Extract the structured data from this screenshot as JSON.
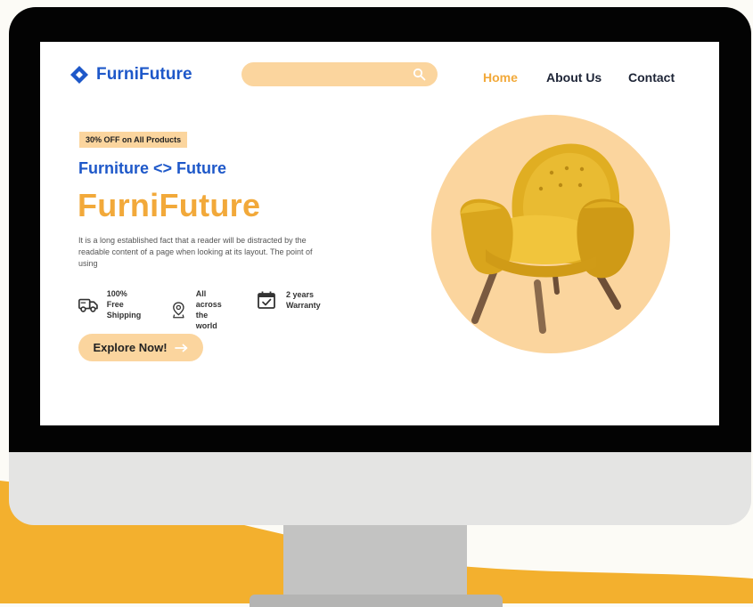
{
  "brand": {
    "name": "FurniFuture",
    "icon": "diamond-logo-icon",
    "color": "#1e58c9"
  },
  "search": {
    "placeholder": "",
    "icon": "search-icon"
  },
  "nav": [
    {
      "label": "Home",
      "active": true
    },
    {
      "label": "About Us",
      "active": false
    },
    {
      "label": "Contact",
      "active": false
    }
  ],
  "hero": {
    "badge": "30% OFF on All Products",
    "tagline": "Furniture <> Future",
    "title": "FurniFuture",
    "description": "It is a long established fact that a reader will be distracted by the readable content of a page when looking at its layout. The point of using",
    "features": [
      {
        "icon": "truck-icon",
        "line1": "100% Free",
        "line2": "Shipping"
      },
      {
        "icon": "location-pin-icon",
        "line1": "All across",
        "line2": "the world"
      },
      {
        "icon": "calendar-check-icon",
        "line1": "2 years",
        "line2": "Warranty"
      }
    ],
    "cta": {
      "label": "Explore Now!",
      "icon": "arrow-right-icon"
    },
    "image": "yellow-armchair"
  },
  "colors": {
    "accent": "#f2a93a",
    "accent_light": "#fbd59e",
    "brand": "#1e58c9",
    "text": "#1d2436"
  }
}
